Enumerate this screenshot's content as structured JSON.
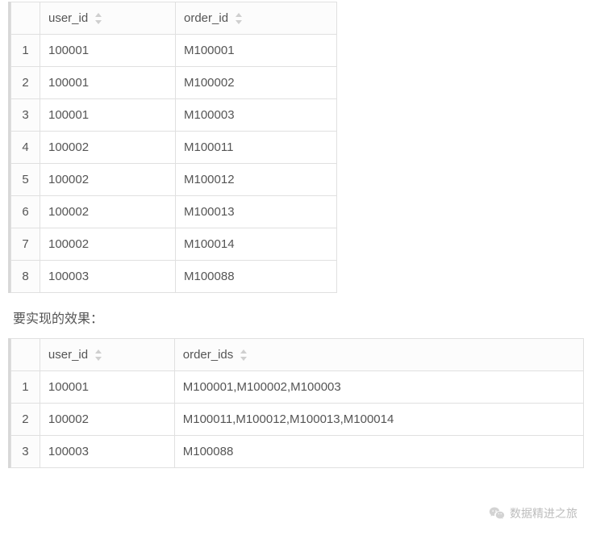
{
  "table1": {
    "headers": {
      "col1": "user_id",
      "col2": "order_id"
    },
    "rows": [
      {
        "n": "1",
        "user_id": "100001",
        "order_id": "M100001"
      },
      {
        "n": "2",
        "user_id": "100001",
        "order_id": "M100002"
      },
      {
        "n": "3",
        "user_id": "100001",
        "order_id": "M100003"
      },
      {
        "n": "4",
        "user_id": "100002",
        "order_id": "M100011"
      },
      {
        "n": "5",
        "user_id": "100002",
        "order_id": "M100012"
      },
      {
        "n": "6",
        "user_id": "100002",
        "order_id": "M100013"
      },
      {
        "n": "7",
        "user_id": "100002",
        "order_id": "M100014"
      },
      {
        "n": "8",
        "user_id": "100003",
        "order_id": "M100088"
      }
    ]
  },
  "section_label": "要实现的效果：",
  "table2": {
    "headers": {
      "col1": "user_id",
      "col2": "order_ids"
    },
    "rows": [
      {
        "n": "1",
        "user_id": "100001",
        "order_ids": "M100001,M100002,M100003"
      },
      {
        "n": "2",
        "user_id": "100002",
        "order_ids": "M100011,M100012,M100013,M100014"
      },
      {
        "n": "3",
        "user_id": "100003",
        "order_ids": "M100088"
      }
    ]
  },
  "watermark": {
    "text": "数据精进之旅"
  }
}
